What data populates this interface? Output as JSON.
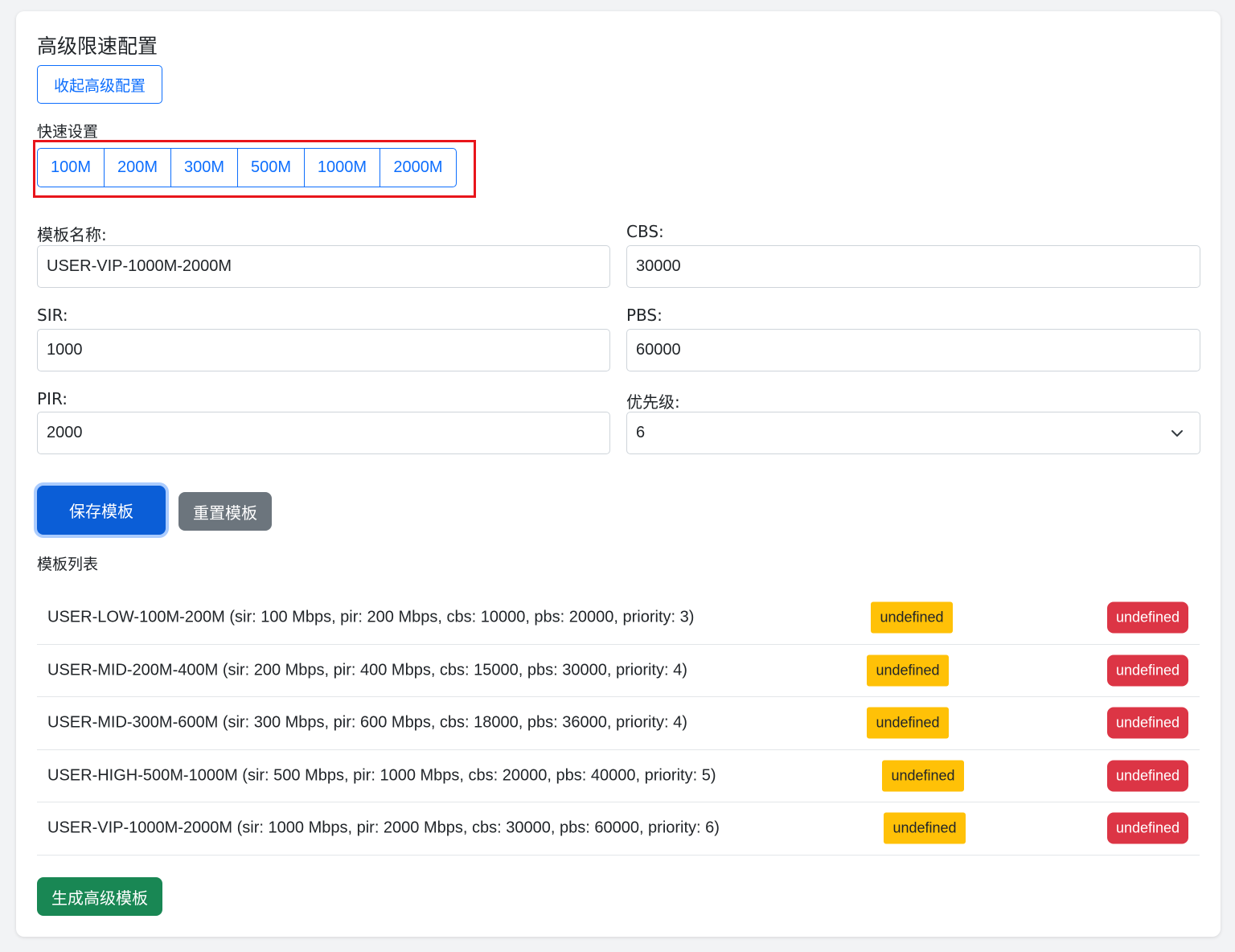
{
  "panel": {
    "title": "高级限速配置",
    "collapse_label": "收起高级配置"
  },
  "quick": {
    "label": "快速设置",
    "buttons": [
      "100M",
      "200M",
      "300M",
      "500M",
      "1000M",
      "2000M"
    ]
  },
  "form": {
    "template_name": {
      "label": "模板名称:",
      "value": "USER-VIP-1000M-2000M"
    },
    "cbs": {
      "label": "CBS:",
      "value": "30000"
    },
    "sir": {
      "label": "SIR:",
      "value": "1000"
    },
    "pbs": {
      "label": "PBS:",
      "value": "60000"
    },
    "pir": {
      "label": "PIR:",
      "value": "2000"
    },
    "priority": {
      "label": "优先级:",
      "value": "6"
    }
  },
  "actions": {
    "save_label": "保存模板",
    "reset_label": "重置模板",
    "generate_label": "生成高级模板"
  },
  "list": {
    "label": "模板列表",
    "rows": [
      {
        "text": "USER-LOW-100M-200M (sir: 100 Mbps, pir: 200 Mbps, cbs: 10000, pbs: 20000, priority: 3)",
        "edit": "undefined",
        "delete": "undefined"
      },
      {
        "text": "USER-MID-200M-400M (sir: 200 Mbps, pir: 400 Mbps, cbs: 15000, pbs: 30000, priority: 4)",
        "edit": "undefined",
        "delete": "undefined"
      },
      {
        "text": "USER-MID-300M-600M (sir: 300 Mbps, pir: 600 Mbps, cbs: 18000, pbs: 36000, priority: 4)",
        "edit": "undefined",
        "delete": "undefined"
      },
      {
        "text": "USER-HIGH-500M-1000M (sir: 500 Mbps, pir: 1000 Mbps, cbs: 20000, pbs: 40000, priority: 5)",
        "edit": "undefined",
        "delete": "undefined"
      },
      {
        "text": "USER-VIP-1000M-2000M (sir: 1000 Mbps, pir: 2000 Mbps, cbs: 30000, pbs: 60000, priority: 6)",
        "edit": "undefined",
        "delete": "undefined"
      }
    ]
  },
  "colors": {
    "primary": "#0d6efd",
    "warning": "#ffc107",
    "danger": "#dc3545",
    "success": "#198754",
    "secondary": "#6c757d",
    "highlight": "#e8151b"
  }
}
